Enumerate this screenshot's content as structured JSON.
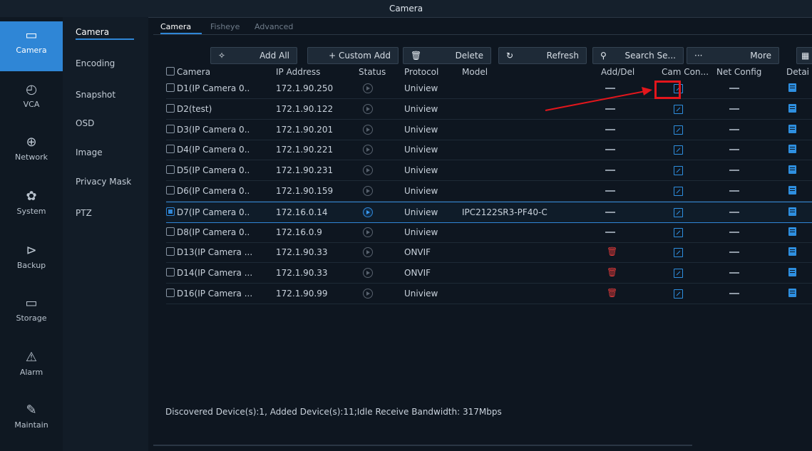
{
  "window": {
    "title": "Camera"
  },
  "left_nav": [
    {
      "label": "Camera",
      "icon": "camera-icon",
      "active": true
    },
    {
      "label": "VCA",
      "icon": "vca-icon"
    },
    {
      "label": "Network",
      "icon": "globe-icon"
    },
    {
      "label": "System",
      "icon": "gear-icon"
    },
    {
      "label": "Backup",
      "icon": "backup-icon"
    },
    {
      "label": "Storage",
      "icon": "disk-icon"
    },
    {
      "label": "Alarm",
      "icon": "warning-icon"
    },
    {
      "label": "Maintain",
      "icon": "wrench-icon"
    }
  ],
  "sub_nav": [
    "Camera",
    "Encoding",
    "Snapshot",
    "OSD",
    "Image",
    "Privacy Mask",
    "PTZ"
  ],
  "tabs": [
    "Camera",
    "Fisheye",
    "Advanced"
  ],
  "toolbar": {
    "add_all": "Add All",
    "custom_add": "+ Custom Add",
    "delete": "Delete",
    "refresh": "Refresh",
    "search": "Search Se...",
    "more": "More",
    "more_icon": "···"
  },
  "table": {
    "headers": [
      "Camera",
      "IP Address",
      "Status",
      "Protocol",
      "Model",
      "Add/Del",
      "Cam Con...",
      "Net Config",
      "Detai"
    ],
    "rows": [
      {
        "camera": "D1(IP Camera 0..",
        "ip": "172.1.90.250",
        "protocol": "Uniview",
        "model": "",
        "live": false,
        "checked": false,
        "add_del": "dash"
      },
      {
        "camera": "D2(test)",
        "ip": "172.1.90.122",
        "protocol": "Uniview",
        "model": "",
        "live": false,
        "checked": false,
        "add_del": "dash"
      },
      {
        "camera": "D3(IP Camera 0..",
        "ip": "172.1.90.201",
        "protocol": "Uniview",
        "model": "",
        "live": false,
        "checked": false,
        "add_del": "dash"
      },
      {
        "camera": "D4(IP Camera 0..",
        "ip": "172.1.90.221",
        "protocol": "Uniview",
        "model": "",
        "live": false,
        "checked": false,
        "add_del": "dash"
      },
      {
        "camera": "D5(IP Camera 0..",
        "ip": "172.1.90.231",
        "protocol": "Uniview",
        "model": "",
        "live": false,
        "checked": false,
        "add_del": "dash"
      },
      {
        "camera": "D6(IP Camera 0..",
        "ip": "172.1.90.159",
        "protocol": "Uniview",
        "model": "",
        "live": false,
        "checked": false,
        "add_del": "dash"
      },
      {
        "camera": "D7(IP Camera 0..",
        "ip": "172.16.0.14",
        "protocol": "Uniview",
        "model": "IPC2122SR3-PF40-C",
        "live": true,
        "checked": true,
        "add_del": "dash"
      },
      {
        "camera": "D8(IP Camera 0..",
        "ip": "172.16.0.9",
        "protocol": "Uniview",
        "model": "",
        "live": false,
        "checked": false,
        "add_del": "dash"
      },
      {
        "camera": "D13(IP Camera ...",
        "ip": "172.1.90.33",
        "protocol": "ONVIF",
        "model": "",
        "live": false,
        "checked": false,
        "add_del": "delete"
      },
      {
        "camera": "D14(IP Camera ...",
        "ip": "172.1.90.33",
        "protocol": "ONVIF",
        "model": "",
        "live": false,
        "checked": false,
        "add_del": "delete"
      },
      {
        "camera": "D16(IP Camera ...",
        "ip": "172.1.90.99",
        "protocol": "Uniview",
        "model": "",
        "live": false,
        "checked": false,
        "add_del": "delete"
      }
    ]
  },
  "status_bar": "Discovered Device(s):1, Added Device(s):11;Idle Receive Bandwidth: 317Mbps",
  "colors": {
    "accent": "#2f86d6",
    "highlight": "#e3161c",
    "delete": "#e03a3a"
  }
}
